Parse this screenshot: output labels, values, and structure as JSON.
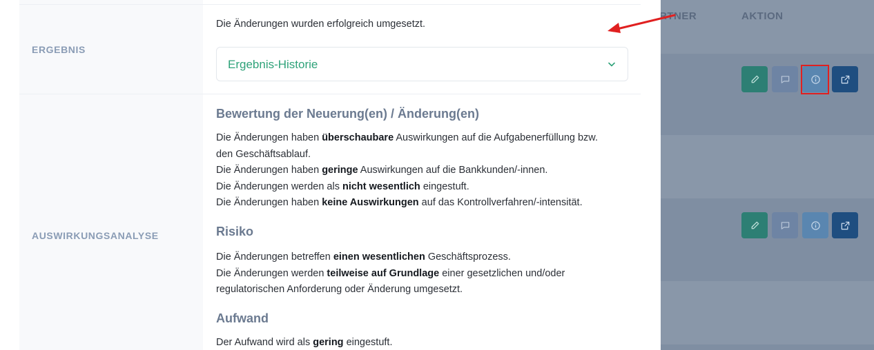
{
  "background_table": {
    "columns": [
      "RTNER",
      "AKTION"
    ],
    "rows": [
      {
        "buttons": [
          "edit-icon",
          "comment-icon",
          "info-icon",
          "external-link-icon"
        ]
      },
      {
        "buttons": [
          "edit-icon",
          "comment-icon",
          "info-icon",
          "external-link-icon"
        ]
      }
    ]
  },
  "detail": {
    "ergebnis": {
      "label": "ERGEBNIS",
      "text": "Die Änderungen wurden erfolgreich umgesetzt.",
      "accordion_title": "Ergebnis-Historie"
    },
    "auswirkung": {
      "label": "AUSWIRKUNGSANALYSE",
      "bewertung": {
        "heading": "Bewertung der Neuerung(en) / Änderung(en)",
        "lines": [
          {
            "pre": "Die Änderungen haben ",
            "bold": "überschaubare",
            "post": " Auswirkungen auf die Aufgabenerfüllung bzw."
          },
          {
            "pre": "den Geschäftsablauf.",
            "bold": "",
            "post": ""
          },
          {
            "pre": "Die Änderungen haben ",
            "bold": "geringe",
            "post": " Auswirkungen auf die Bankkunden/-innen."
          },
          {
            "pre": "Die Änderungen werden als ",
            "bold": "nicht wesentlich",
            "post": " eingestuft."
          },
          {
            "pre": "Die Änderungen haben ",
            "bold": "keine Auswirkungen",
            "post": " auf das Kontrollverfahren/-intensität."
          }
        ]
      },
      "risiko": {
        "heading": "Risiko",
        "lines": [
          {
            "pre": "Die Änderungen betreffen ",
            "bold": "einen wesentlichen",
            "post": " Geschäftsprozess."
          },
          {
            "pre": "Die Änderungen werden ",
            "bold": "teilweise auf Grundlage",
            "post": " einer gesetzlichen und/oder"
          },
          {
            "pre": "regulatorischen Anforderung oder Änderung umgesetzt.",
            "bold": "",
            "post": ""
          }
        ]
      },
      "aufwand": {
        "heading": "Aufwand",
        "lines": [
          {
            "pre": "Der Aufwand wird als ",
            "bold": "gering",
            "post": " eingestuft."
          }
        ]
      }
    }
  },
  "annotation": {
    "arrow_color": "#e02020",
    "highlight_color": "#e02020"
  },
  "colors": {
    "accent_green": "#2ea279",
    "label_gray": "#8a9cb5",
    "heading_gray": "#6b7a90"
  }
}
